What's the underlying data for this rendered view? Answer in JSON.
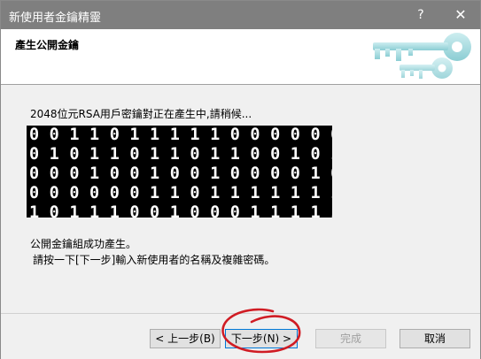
{
  "window": {
    "title": "新使用者金鑰精靈",
    "help_label": "?",
    "close_label": "✕"
  },
  "header": {
    "title": "產生公開金鑰",
    "banner_icon": "keys-icon"
  },
  "content": {
    "generating_text": "2048位元RSA用戶密鑰對正在產生中,請稍候...",
    "binary_rows": [
      "0011011111000000001",
      "0101101101100101010",
      "0001001001000010110",
      "0000001101111111110",
      "1011100100011111101"
    ],
    "done_text": "公開金鑰組成功產生。",
    "hint_text": "請按一下[下一步]輸入新使用者的名稱及複雜密碼。"
  },
  "buttons": {
    "back": "< 上一步(B)",
    "next": "下一步(N) >",
    "finish": "完成",
    "cancel": "取消"
  },
  "colors": {
    "annotation": "#d01c24",
    "focus_border": "#0078d7"
  }
}
